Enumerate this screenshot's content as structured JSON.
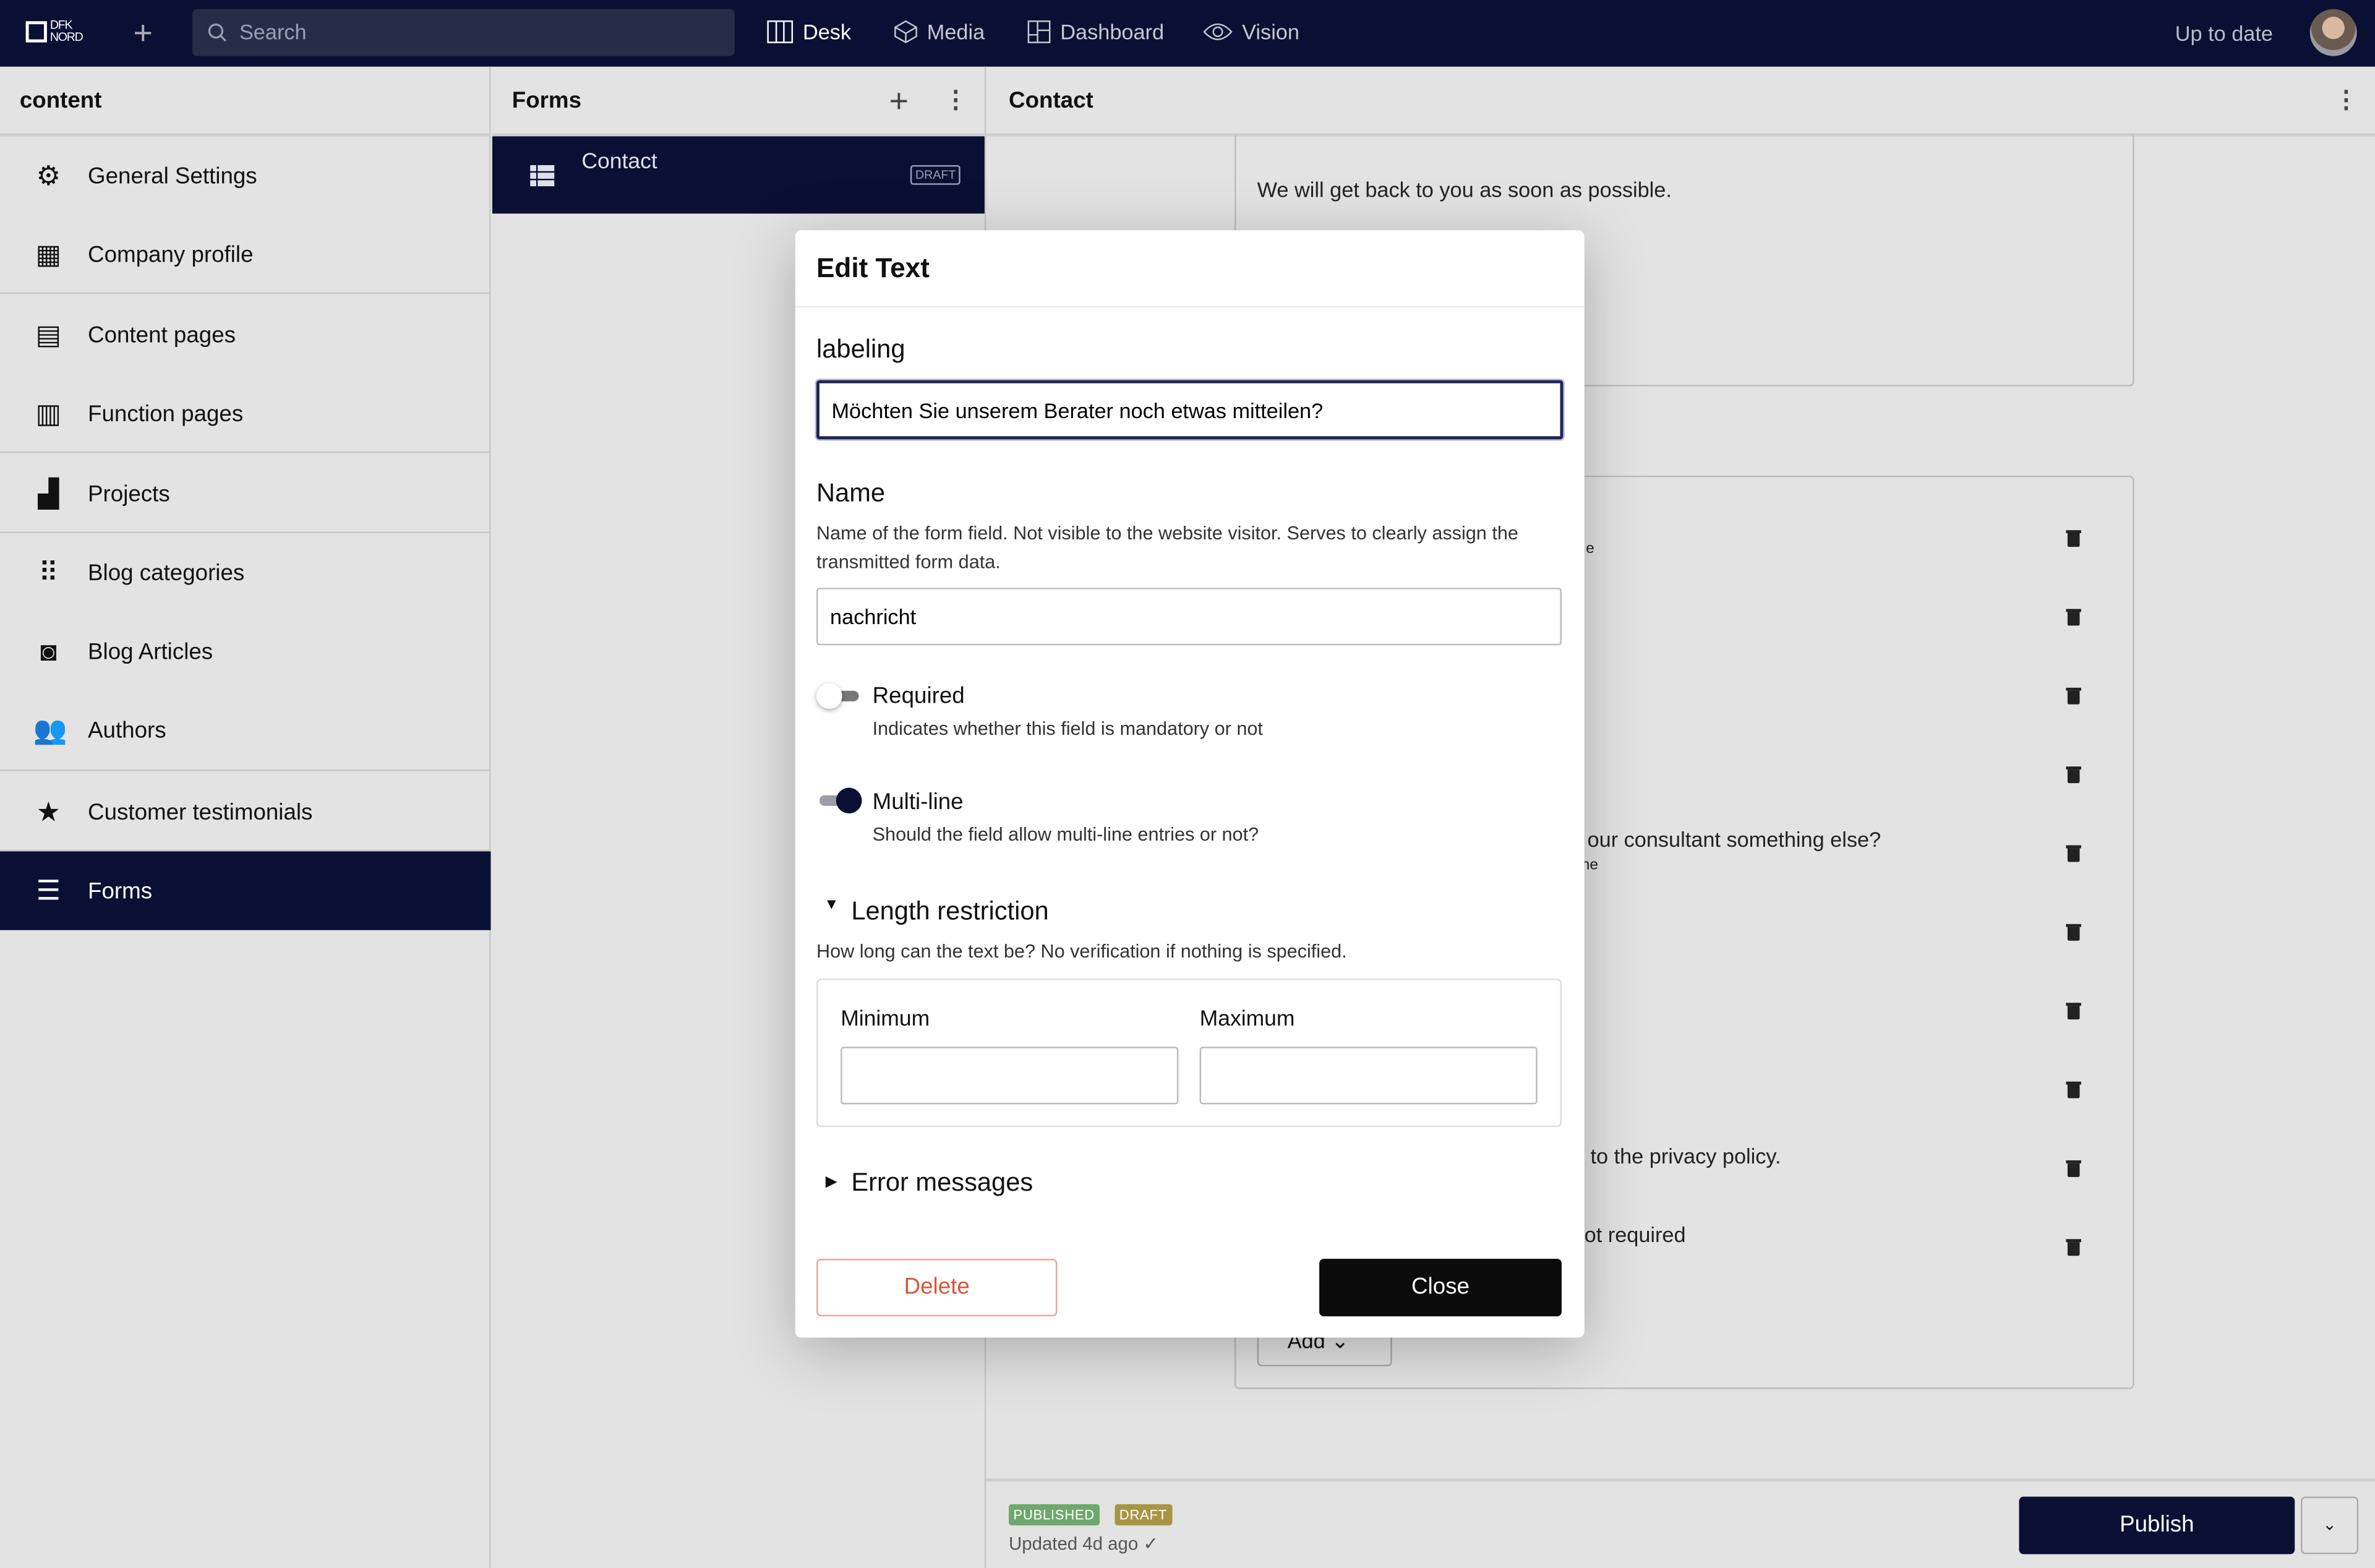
{
  "topbar": {
    "logo": "DFK NORD",
    "search_placeholder": "Search",
    "nav": [
      "Desk",
      "Media",
      "Dashboard",
      "Vision"
    ],
    "status": "Up to date"
  },
  "sidebar": {
    "title": "content",
    "items": [
      {
        "label": "General Settings",
        "icon": "gear-icon"
      },
      {
        "label": "Company profile",
        "icon": "building-icon"
      },
      {
        "label": "Content pages",
        "icon": "page-icon"
      },
      {
        "label": "Function pages",
        "icon": "document-icon"
      },
      {
        "label": "Projects",
        "icon": "city-icon"
      },
      {
        "label": "Blog categories",
        "icon": "grid-icon"
      },
      {
        "label": "Blog Articles",
        "icon": "blog-icon"
      },
      {
        "label": "Authors",
        "icon": "people-icon"
      },
      {
        "label": "Customer testimonials",
        "icon": "star-icon"
      },
      {
        "label": "Forms",
        "icon": "list-icon",
        "active": true
      }
    ]
  },
  "forms_pane": {
    "title": "Forms",
    "items": [
      {
        "label": "Contact",
        "badge": "DRAFT"
      }
    ]
  },
  "document": {
    "title": "Contact",
    "intro_text": "We will get back to you as soon as possible.",
    "row_fragments": [
      "e",
      "our consultant something else?",
      "ne",
      "to the privacy policy.",
      "ot required"
    ],
    "add_label": "Add",
    "status_badges": [
      "PUBLISHED",
      "DRAFT"
    ],
    "updated": "Updated 4d ago ✓",
    "publish_label": "Publish"
  },
  "modal": {
    "title": "Edit Text",
    "labeling": {
      "label": "labeling",
      "value": "Möchten Sie unserem Berater noch etwas mitteilen?"
    },
    "name": {
      "label": "Name",
      "description": "Name of the form field. Not visible to the website visitor. Serves to clearly assign the transmitted form data.",
      "value": "nachricht"
    },
    "required": {
      "label": "Required",
      "description": "Indicates whether this field is mandatory or not",
      "on": false
    },
    "multiline": {
      "label": "Multi-line",
      "description": "Should the field allow multi-line entries or not?",
      "on": true
    },
    "length": {
      "label": "Length restriction",
      "description": "How long can the text be? No verification if nothing is specified.",
      "min_label": "Minimum",
      "max_label": "Maximum",
      "min_value": "",
      "max_value": ""
    },
    "errors": {
      "label": "Error messages"
    },
    "delete_label": "Delete",
    "close_label": "Close"
  },
  "colors": {
    "navy": "#0a1033",
    "published": "#6ea86e",
    "draft": "#a89544",
    "danger": "#d9553b"
  }
}
